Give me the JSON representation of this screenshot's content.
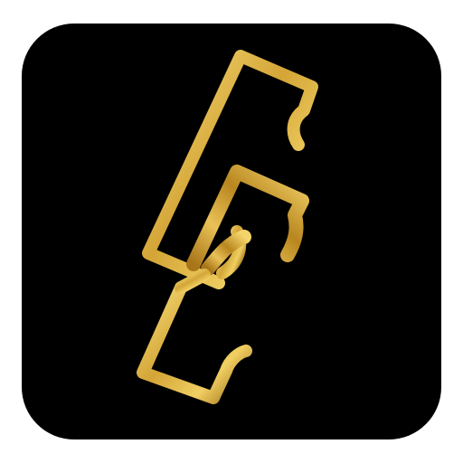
{
  "app_icon": {
    "background_color": "#000000",
    "logo_icon": "gold-chain-link-monogram-icon",
    "logo_colors": {
      "gold_light": "#f7de7a",
      "gold_mid": "#d4a537",
      "gold_dark": "#9b6a12"
    }
  }
}
